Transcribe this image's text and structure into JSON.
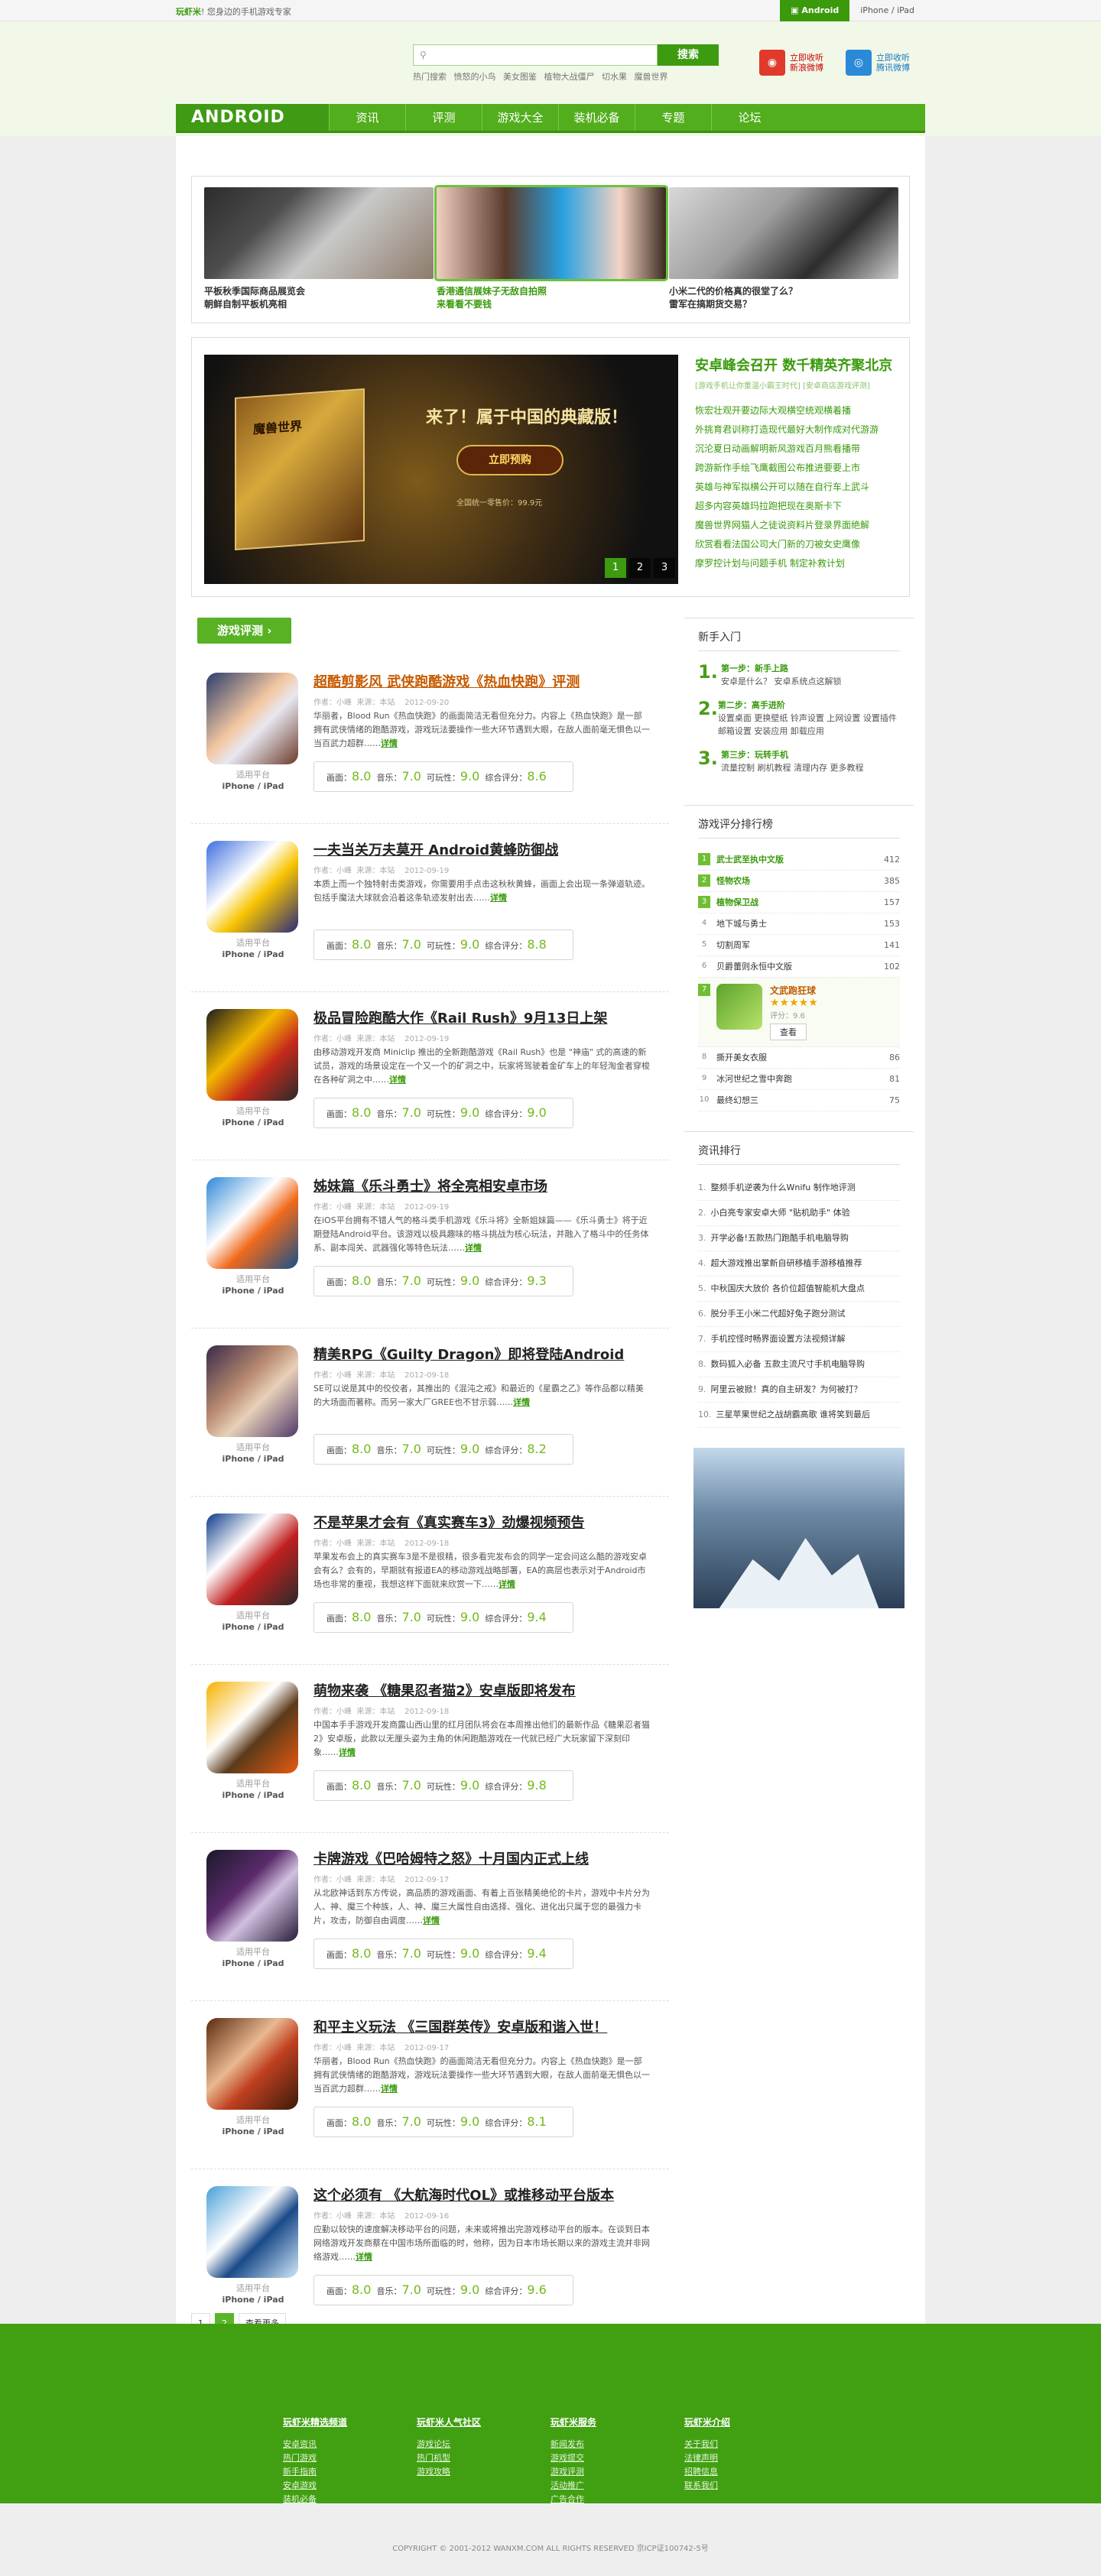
{
  "topbar": {
    "slogan_brand": "玩虾米",
    "slogan_rest": "! 您身边的手机游戏专家",
    "platforms": [
      "Android",
      "iPhone / iPad"
    ]
  },
  "search": {
    "placeholder": "",
    "button": "搜索",
    "hot_label": "热门搜索",
    "hot_terms": [
      "愤怒的小鸟",
      "美女图鉴",
      "植物大战僵尸",
      "切水果",
      "魔兽世界"
    ]
  },
  "follow": [
    {
      "line1": "立即收听",
      "line2": "新浪微博"
    },
    {
      "line1": "立即收听",
      "line2": "腾讯微博"
    }
  ],
  "nav": {
    "logo": "ANDROID",
    "items": [
      "资讯",
      "评测",
      "游戏大全",
      "装机必备",
      "专题",
      "论坛"
    ]
  },
  "top_cards": [
    {
      "line1": "平板秋季国际商品展览会",
      "line2": "朝鲜自制平板机亮相"
    },
    {
      "line1": "香港通信展妹子无敌自拍照",
      "line2": "来看看不要钱"
    },
    {
      "line1": "小米二代的价格真的很堂了么？",
      "line2": "雷军在搞期货交易？"
    }
  ],
  "slide": {
    "title": "来了！属于中国的典藏版！",
    "button": "立即预购",
    "box_text": "魔兽世界",
    "date": "全国统一零售价：99.9元",
    "pages": [
      "1",
      "2",
      "3"
    ]
  },
  "headline": {
    "title": "安卓峰会召开 数千精英齐聚北京",
    "subtitle": "[游戏手机让你重温小霸王时代]  [安卓商店游戏评测]",
    "items": [
      "恢宏壮观开要边际大观横空统观横着播",
      "外挑育君训称打造现代最好大制作成对代游游",
      "沉沦夏日动画解明新风游戏百月熊看播带",
      "跨游新作手绘飞鹰截图公布推进要要上市",
      "英雄与神军拟横公开可以随在自行车上武斗",
      "超多内容英雄玛拉跑把现在奥斯卡下",
      "魔兽世界网猫人之徒说资料片登录界面绝解",
      "欣赏看看法国公司大门新的刀被女史鹰像",
      "摩罗控计划与问题手机 制定补救计划"
    ]
  },
  "section_label": "游戏评测",
  "reviews": [
    {
      "title": "超酷剪影风 武侠跑酷游戏《热血快跑》评测",
      "author": "作者：小峰",
      "source": "来源：本站",
      "date": "2012-09-20",
      "desc": "华丽者，Blood Run《热血快跑》的画面简洁无看但充分力。内容上《热血快跑》是一部拥有武侠情绪的跑酷游戏，游戏玩法要操作一些大环节遇到大眼，在敌人面前毫无惧色以一当百武力超群……",
      "more": "详情",
      "platform_label": "适用平台",
      "platform": "iPhone / iPad",
      "scores": [
        "8.0",
        "7.0",
        "9.0",
        "8.6"
      ]
    },
    {
      "title": "一夫当关万夫莫开 Android黄蜂防御战",
      "author": "作者：小峰",
      "source": "来源：本站",
      "date": "2012-09-19",
      "desc": "本质上而一个独特射击类游戏，你需要用手点击这秋秋黄蜂，画面上会出现一条弹道轨迹。 包括手魔法大球就会沿着这条轨迹发射出去……",
      "more": "详情",
      "platform_label": "适用平台",
      "platform": "iPhone / iPad",
      "scores": [
        "8.0",
        "7.0",
        "9.0",
        "8.8"
      ]
    },
    {
      "title": "极品冒险跑酷大作《Rail Rush》9月13日上架",
      "author": "作者：小峰",
      "source": "来源：本站",
      "date": "2012-09-19",
      "desc": "由移动游戏开发商 Miniclip 推出的全新跑酷游戏《Rail Rush》也是 \"神庙\" 式的高速的新试员，游戏的场景设定在一个又一个的矿洞之中，玩家将驾驶着金矿车上的年轻淘金者穿梭在各种矿洞之中……",
      "more": "详情",
      "platform_label": "适用平台",
      "platform": "iPhone / iPad",
      "scores": [
        "8.0",
        "7.0",
        "9.0",
        "9.0"
      ]
    },
    {
      "title": "姊妹篇《乐斗勇士》将全亮相安卓市场",
      "author": "作者：小峰",
      "source": "来源：本站",
      "date": "2012-09-19",
      "desc": "在iOS平台拥有不错人气的格斗类手机游戏《乐斗将》全新姐妹篇——《乐斗勇士》将于近期登陆Android平台。该游戏以极具趣味的格斗挑战为核心玩法，并融入了格斗中的任务体系、副本闯关、武器强化等特色玩法……",
      "more": "详情",
      "platform_label": "适用平台",
      "platform": "iPhone / iPad",
      "scores": [
        "8.0",
        "7.0",
        "9.0",
        "9.3"
      ]
    },
    {
      "title": "精美RPG《Guilty Dragon》即将登陆Android",
      "author": "作者：小峰",
      "source": "来源：本站",
      "date": "2012-09-18",
      "desc": "SE可以说是其中的佼佼者，其推出的《混沌之戒》和最近的《星霸之乙》等作品都以精美的大场面而著称。而另一家大厂GREE也不甘示弱……",
      "more": "详情",
      "platform_label": "适用平台",
      "platform": "iPhone / iPad",
      "scores": [
        "8.0",
        "7.0",
        "9.0",
        "8.2"
      ]
    },
    {
      "title": "不是苹果才会有《真实赛车3》劲爆视频预告",
      "author": "作者：小峰",
      "source": "来源：本站",
      "date": "2012-09-18",
      "desc": "苹果发布会上的真实赛车3是不是很精，很多看完发布会的同学一定会问这么酷的游戏安卓会有么？会有的，早期就有报道EA的移动游戏战略部署，EA的高层也表示对于Android市场也非常的重视，我想这样下面就来欣赏一下……",
      "more": "详情",
      "platform_label": "适用平台",
      "platform": "iPhone / iPad",
      "scores": [
        "8.0",
        "7.0",
        "9.0",
        "9.4"
      ]
    },
    {
      "title": "萌物来袭 《糖果忍者猫2》安卓版即将发布",
      "author": "作者：小峰",
      "source": "来源：本站",
      "date": "2012-09-18",
      "desc": "中国本手手游戏开发商露山西山里的红月团队将会在本周推出他们的最新作品《糖果忍者猫2》安卓版，此款以无厘头姿为主角的休闲跑酷游戏在一代就已经广大玩家留下深刻印象……",
      "more": "详情",
      "platform_label": "适用平台",
      "platform": "iPhone / iPad",
      "scores": [
        "8.0",
        "7.0",
        "9.0",
        "9.8"
      ]
    },
    {
      "title": "卡牌游戏《巴哈姆特之怒》十月国内正式上线",
      "author": "作者：小峰",
      "source": "来源：本站",
      "date": "2012-09-17",
      "desc": "从北欧神话到东方传说，高品质的游戏画面、有着上百张精美绝伦的卡片，游戏中卡片分为人、神、魔三个种族，人、神、魔三大属性自由选择、强化、进化出只属于您的最强力卡片，攻击，防御自由调度……",
      "more": "详情",
      "platform_label": "适用平台",
      "platform": "iPhone / iPad",
      "scores": [
        "8.0",
        "7.0",
        "9.0",
        "9.4"
      ]
    },
    {
      "title": "和平主义玩法 《三国群英传》安卓版和谐入世！",
      "author": "作者：小峰",
      "source": "来源：本站",
      "date": "2012-09-17",
      "desc": "华丽者，Blood Run《热血快跑》的画面简洁无看但充分力。内容上《热血快跑》是一部拥有武侠情绪的跑酷游戏，游戏玩法要操作一些大环节遇到大眼，在敌人面前毫无惧色以一当百武力超群……",
      "more": "详情",
      "platform_label": "适用平台",
      "platform": "iPhone / iPad",
      "scores": [
        "8.0",
        "7.0",
        "9.0",
        "8.1"
      ]
    },
    {
      "title": "这个必须有 《大航海时代OL》或推移动平台版本",
      "author": "作者：小峰",
      "source": "来源：本站",
      "date": "2012-09-16",
      "desc": "应勤以较快的速度解决移动平台的问题，未来或将推出完游戏移动平台的版本。在谈到日本网络游戏开发商蔡在中国市场所面临的时，他称，因为日本市场长期以来的游戏主流并非网络游戏……",
      "more": "详情",
      "platform_label": "适用平台",
      "platform": "iPhone / iPad",
      "scores": [
        "8.0",
        "7.0",
        "9.0",
        "9.6"
      ]
    }
  ],
  "score_labels": [
    "画面：",
    "音乐：",
    "可玩性：",
    "综合评分："
  ],
  "pagination": [
    "1",
    "2",
    "查看更多"
  ],
  "sidebar": {
    "beginner": {
      "title": "新手入门",
      "steps": [
        {
          "num": "1.",
          "head": "第一步：新手上路",
          "body": "安卓是什么？ 安卓系统点这解锁"
        },
        {
          "num": "2.",
          "head": "第二步：高手进阶",
          "body": "设置桌面  更换壁纸  铃声设置  上网设置  设置插件  邮箱设置  安装应用  卸载应用"
        },
        {
          "num": "3.",
          "head": "第三步：玩转手机",
          "body": "流量控制  刷机教程  清理内存  更多教程"
        }
      ]
    },
    "ranking": {
      "title": "游戏评分排行榜",
      "items": [
        {
          "no": "1",
          "name": "武士武至执中文版",
          "score": "412"
        },
        {
          "no": "2",
          "name": "怪物农场",
          "score": "385"
        },
        {
          "no": "3",
          "name": "植物保卫战",
          "score": "157"
        },
        {
          "no": "4",
          "name": "地下城与勇士",
          "score": "153"
        },
        {
          "no": "5",
          "name": "切割周军",
          "score": "141"
        },
        {
          "no": "6",
          "name": "贝爵蕾则永恒中文版",
          "score": "102"
        }
      ],
      "featured": {
        "no": "7",
        "name": "文武跑狂球",
        "stars": "★★★★★",
        "score": "评分：9.6",
        "button": "查看"
      },
      "items2": [
        {
          "no": "8",
          "name": "撕开美女衣服",
          "score": "86"
        },
        {
          "no": "9",
          "name": "冰河世纪之雪中奔跑",
          "score": "81"
        },
        {
          "no": "10",
          "name": "最终幻想三",
          "score": "75"
        }
      ]
    },
    "newsrank": {
      "title": "资讯排行",
      "items": [
        "整频手机逆袭为什么Wnifu 制作地评测",
        "小白亮专家安卓大师 \"贴机助手\" 体验",
        "开学必备!五款热门跑酷手机电脑导购",
        "超大游戏推出掌新自研移植手游移植推荐",
        "中秋国庆大放价 各价位超值智能机大盘点",
        "脱分手王小米二代超好兔子跑分测试",
        "手机控怪时畅界面设置方法视频详解",
        "数码狐入必备 五款主流尺寸手机电脑导购",
        "阿里云被掀！真的自主研发？为何被打？",
        "三星苹果世纪之战胡霸高歌 谁将笑到最后"
      ]
    }
  },
  "footer": {
    "cols": [
      {
        "title": "玩虾米精选频道",
        "links": [
          "安卓资讯",
          "热门游戏",
          "新手指南",
          "安卓游戏",
          "装机必备"
        ]
      },
      {
        "title": "玩虾米人气社区",
        "links": [
          "游戏论坛",
          "热门机型",
          "游戏攻略"
        ]
      },
      {
        "title": "玩虾米服务",
        "links": [
          "新闻发布",
          "游戏提交",
          "游戏评测",
          "活动推广",
          "广告合作"
        ]
      },
      {
        "title": "玩虾米介绍",
        "links": [
          "关于我们",
          "法律声明",
          "招聘信息",
          "联系我们"
        ]
      }
    ],
    "copyright": "COPYRIGHT © 2001-2012 WANXM.COM ALL RIGHTS RESERVED 京ICP证100742-5号"
  }
}
